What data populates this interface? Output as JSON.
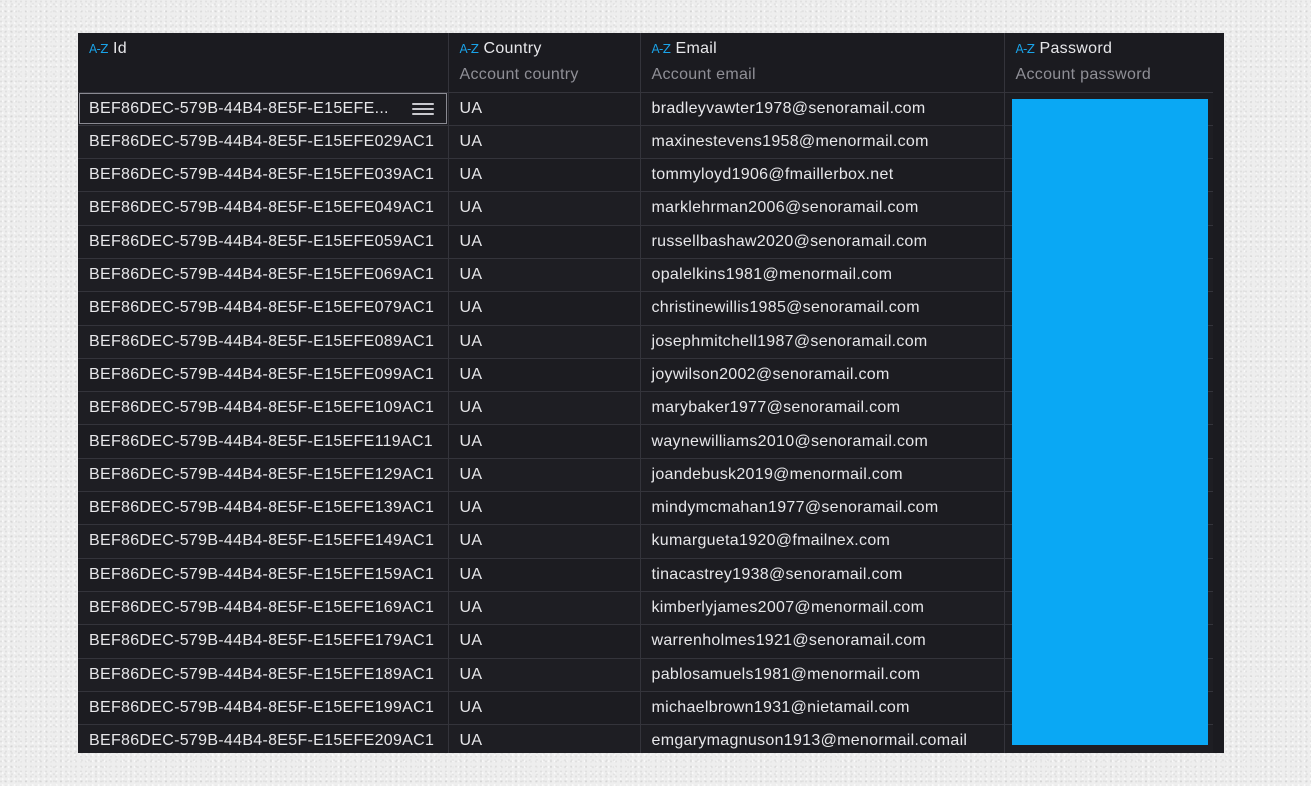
{
  "colors": {
    "grid_background": "#1b1b20",
    "accent_icon": "#1aa3e8",
    "redaction": "#0aa8f4",
    "header_subtext": "#8f8f96"
  },
  "header": {
    "sort_icon_glyph": "A-Z",
    "columns": [
      {
        "title": "Id",
        "description": ""
      },
      {
        "title": "Country",
        "description": "Account country"
      },
      {
        "title": "Email",
        "description": "Account email"
      },
      {
        "title": "Password",
        "description": "Account password"
      }
    ]
  },
  "rows": [
    {
      "id": "BEF86DEC-579B-44B4-8E5F-E15EFE...",
      "country": "UA",
      "email": "bradleyvawter1978@senoramail.com",
      "password": ""
    },
    {
      "id": "BEF86DEC-579B-44B4-8E5F-E15EFE029AC1",
      "country": "UA",
      "email": "maxinestevens1958@menormail.com",
      "password": ""
    },
    {
      "id": "BEF86DEC-579B-44B4-8E5F-E15EFE039AC1",
      "country": "UA",
      "email": "tommyloyd1906@fmaillerbox.net",
      "password": ""
    },
    {
      "id": "BEF86DEC-579B-44B4-8E5F-E15EFE049AC1",
      "country": "UA",
      "email": "marklehrman2006@senoramail.com",
      "password": ""
    },
    {
      "id": "BEF86DEC-579B-44B4-8E5F-E15EFE059AC1",
      "country": "UA",
      "email": "russellbashaw2020@senoramail.com",
      "password": ""
    },
    {
      "id": "BEF86DEC-579B-44B4-8E5F-E15EFE069AC1",
      "country": "UA",
      "email": "opalelkins1981@menormail.com",
      "password": ""
    },
    {
      "id": "BEF86DEC-579B-44B4-8E5F-E15EFE079AC1",
      "country": "UA",
      "email": "christinewillis1985@senoramail.com",
      "password": ""
    },
    {
      "id": "BEF86DEC-579B-44B4-8E5F-E15EFE089AC1",
      "country": "UA",
      "email": "josephmitchell1987@senoramail.com",
      "password": ""
    },
    {
      "id": "BEF86DEC-579B-44B4-8E5F-E15EFE099AC1",
      "country": "UA",
      "email": "joywilson2002@senoramail.com",
      "password": ""
    },
    {
      "id": "BEF86DEC-579B-44B4-8E5F-E15EFE109AC1",
      "country": "UA",
      "email": "marybaker1977@senoramail.com",
      "password": ""
    },
    {
      "id": "BEF86DEC-579B-44B4-8E5F-E15EFE119AC1",
      "country": "UA",
      "email": "waynewilliams2010@senoramail.com",
      "password": ""
    },
    {
      "id": "BEF86DEC-579B-44B4-8E5F-E15EFE129AC1",
      "country": "UA",
      "email": "joandebusk2019@menormail.com",
      "password": ""
    },
    {
      "id": "BEF86DEC-579B-44B4-8E5F-E15EFE139AC1",
      "country": "UA",
      "email": "mindymcmahan1977@senoramail.com",
      "password": ""
    },
    {
      "id": "BEF86DEC-579B-44B4-8E5F-E15EFE149AC1",
      "country": "UA",
      "email": "kumargueta1920@fmailnex.com",
      "password": ""
    },
    {
      "id": "BEF86DEC-579B-44B4-8E5F-E15EFE159AC1",
      "country": "UA",
      "email": "tinacastrey1938@senoramail.com",
      "password": ""
    },
    {
      "id": "BEF86DEC-579B-44B4-8E5F-E15EFE169AC1",
      "country": "UA",
      "email": "kimberlyjames2007@menormail.com",
      "password": ""
    },
    {
      "id": "BEF86DEC-579B-44B4-8E5F-E15EFE179AC1",
      "country": "UA",
      "email": "warrenholmes1921@senoramail.com",
      "password": ""
    },
    {
      "id": "BEF86DEC-579B-44B4-8E5F-E15EFE189AC1",
      "country": "UA",
      "email": "pablosamuels1981@menormail.com",
      "password": ""
    },
    {
      "id": "BEF86DEC-579B-44B4-8E5F-E15EFE199AC1",
      "country": "UA",
      "email": "michaelbrown1931@nietamail.com",
      "password": ""
    },
    {
      "id": "BEF86DEC-579B-44B4-8E5F-E15EFE209AC1",
      "country": "UA",
      "email": "emgarymagnuson1913@menormail.comail",
      "password": ""
    }
  ]
}
